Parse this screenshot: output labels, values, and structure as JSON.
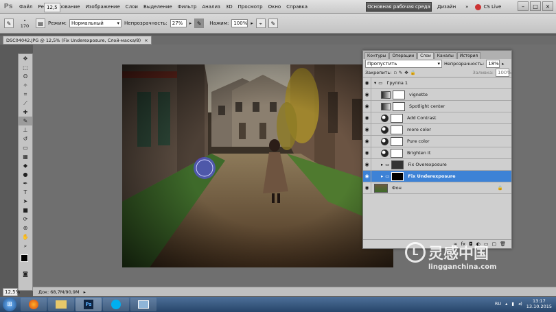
{
  "app": {
    "logo": "Ps"
  },
  "menu": [
    "Файл",
    "Редактирование",
    "Изображение",
    "Слои",
    "Выделение",
    "Фильтр",
    "Анализ",
    "3D",
    "Просмотр",
    "Окно",
    "Справка"
  ],
  "menubar_extras": {
    "zoom": "12,5",
    "workspace": "Основная рабочая среда",
    "design": "Дизайн",
    "more": "»",
    "cslive": "CS Live"
  },
  "window_controls": [
    "–",
    "□",
    "×"
  ],
  "options": {
    "brush_size": "170",
    "mode_label": "Режим:",
    "mode_value": "Нормальный",
    "opacity_label": "Непрозрачность:",
    "opacity_value": "27%",
    "flow_label": "Нажим:",
    "flow_value": "100%"
  },
  "document": {
    "tab_title": "DSC04042.JPG @ 12,5% (Fix Underexposure, Слой-маска/8)",
    "close": "×"
  },
  "layers_panel": {
    "tabs": [
      "Контуры",
      "Операции",
      "Слои",
      "Каналы",
      "История"
    ],
    "active_tab": "Слои",
    "blend_mode": "Пропустить",
    "opacity_label": "Непрозрачность:",
    "opacity_value": "18%",
    "lock_label": "Закрепить:",
    "fill_label": "Заливка:",
    "fill_value": "100%",
    "layers": [
      {
        "name": "Группа 1",
        "kind": "group-open"
      },
      {
        "name": "vignette",
        "kind": "gradient"
      },
      {
        "name": "Spotlight center",
        "kind": "gradient"
      },
      {
        "name": "Add Contrast",
        "kind": "adjust"
      },
      {
        "name": "more color",
        "kind": "adjust"
      },
      {
        "name": "Pure color",
        "kind": "adjust"
      },
      {
        "name": "Brighten It",
        "kind": "adjust"
      },
      {
        "name": "Fix Overexposure",
        "kind": "group"
      },
      {
        "name": "Fix Underexposure",
        "kind": "group",
        "selected": true
      },
      {
        "name": "Фон",
        "kind": "background"
      }
    ]
  },
  "status": {
    "zoom": "12,5%",
    "doc": "Док: 68,7M/90,9M"
  },
  "watermark": {
    "cn": "灵感中国",
    "url": "lingganchina.com"
  },
  "taskbar": {
    "lang": "RU",
    "time": "13:17",
    "date": "13.10.2015"
  },
  "colors": {
    "selected_layer": "#3d82d6",
    "workspace_button": "#5a5a5a"
  }
}
